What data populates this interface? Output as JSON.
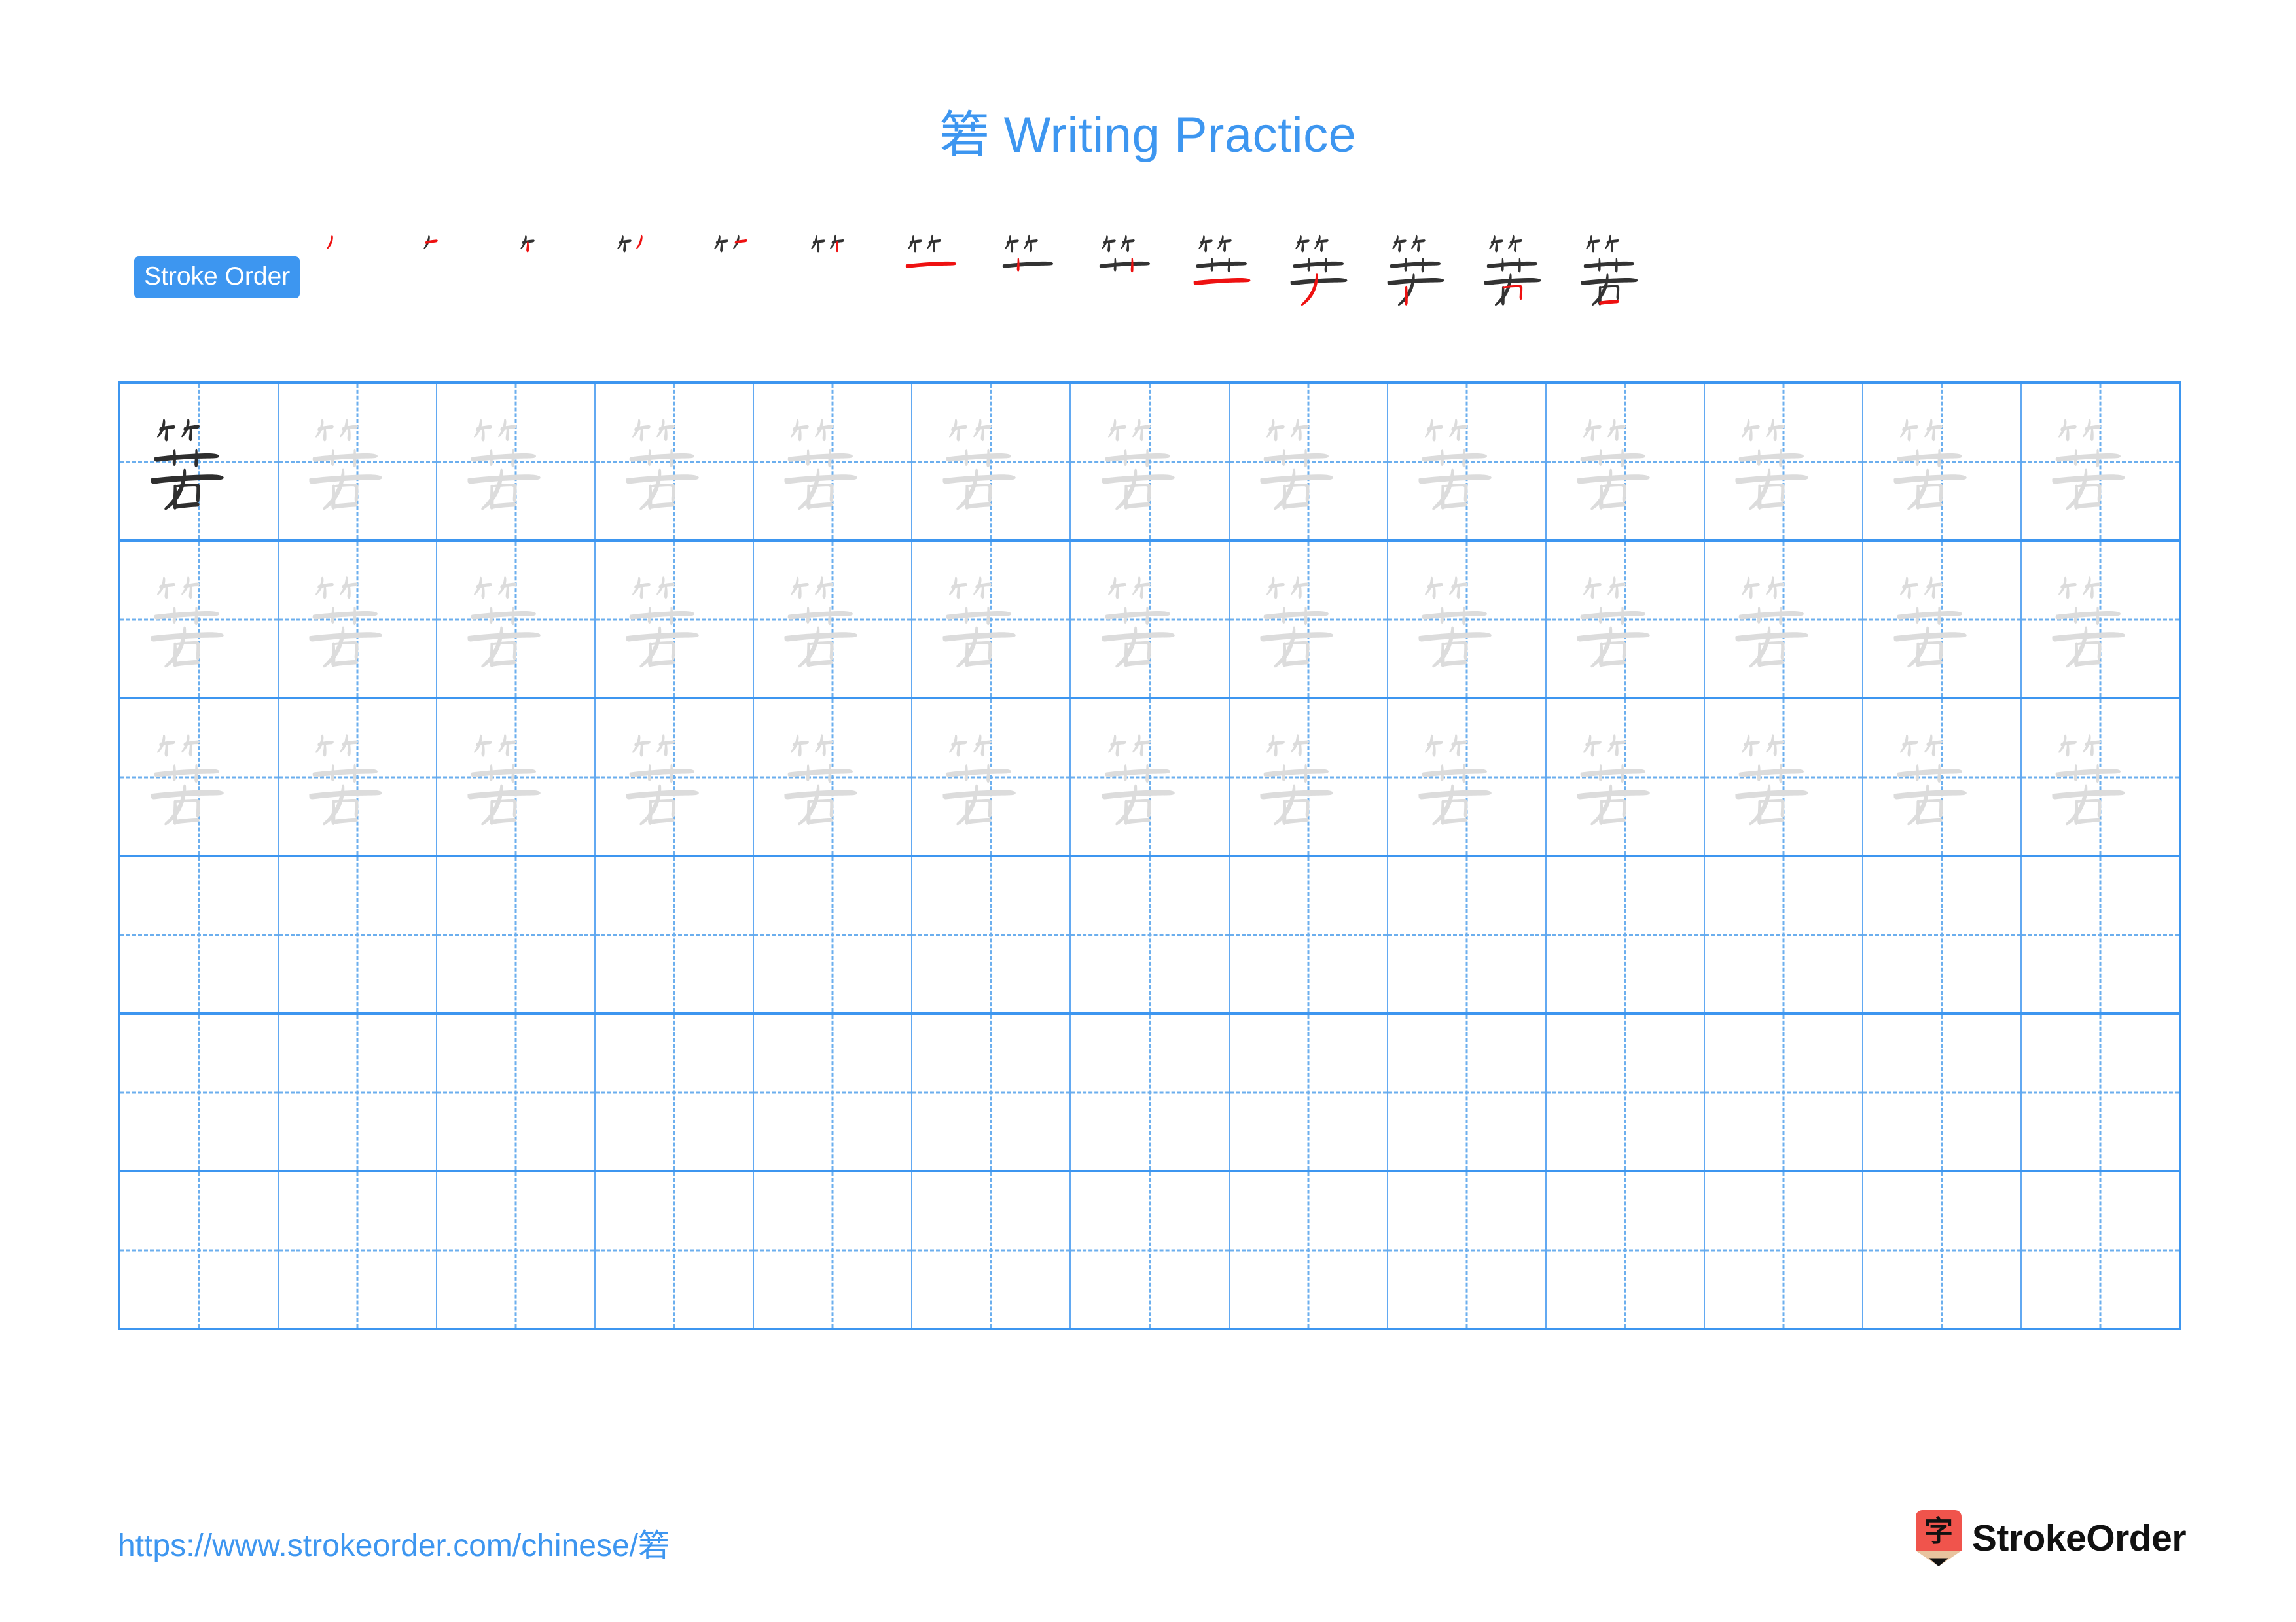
{
  "title": {
    "character": "箬",
    "text": " Writing Practice",
    "color": "#3d96f0"
  },
  "stroke_order": {
    "badge_label": "Stroke Order",
    "badge_bg": "#3d96f0",
    "badge_text_color": "#ffffff",
    "existing_stroke_color": "#333333",
    "new_stroke_color": "#ee1111",
    "total_strokes": 14,
    "steps": [
      {
        "index": 1,
        "strokes_shown": 1,
        "new_stroke": 1
      },
      {
        "index": 2,
        "strokes_shown": 2,
        "new_stroke": 2
      },
      {
        "index": 3,
        "strokes_shown": 3,
        "new_stroke": 3
      },
      {
        "index": 4,
        "strokes_shown": 4,
        "new_stroke": 4
      },
      {
        "index": 5,
        "strokes_shown": 5,
        "new_stroke": 5
      },
      {
        "index": 6,
        "strokes_shown": 6,
        "new_stroke": 6
      },
      {
        "index": 7,
        "strokes_shown": 7,
        "new_stroke": 7
      },
      {
        "index": 8,
        "strokes_shown": 8,
        "new_stroke": 8
      },
      {
        "index": 9,
        "strokes_shown": 9,
        "new_stroke": 9
      },
      {
        "index": 10,
        "strokes_shown": 10,
        "new_stroke": 10
      },
      {
        "index": 11,
        "strokes_shown": 11,
        "new_stroke": 11
      },
      {
        "index": 12,
        "strokes_shown": 12,
        "new_stroke": 12
      },
      {
        "index": 13,
        "strokes_shown": 13,
        "new_stroke": 13
      },
      {
        "index": 14,
        "strokes_shown": 14,
        "new_stroke": 14
      }
    ]
  },
  "practice_grid": {
    "columns": 13,
    "rows": 6,
    "grid_line_color": "#3d96f0",
    "guide_line_color": "#6cafee",
    "model_char_color": "#2e2e2e",
    "trace_char_color": "#dcdcdc",
    "character": "箬",
    "row_fill": [
      {
        "row": 1,
        "model_cells": 1,
        "traced_cells": 12,
        "empty_cells": 0
      },
      {
        "row": 2,
        "model_cells": 0,
        "traced_cells": 13,
        "empty_cells": 0
      },
      {
        "row": 3,
        "model_cells": 0,
        "traced_cells": 13,
        "empty_cells": 0
      },
      {
        "row": 4,
        "model_cells": 0,
        "traced_cells": 0,
        "empty_cells": 13
      },
      {
        "row": 5,
        "model_cells": 0,
        "traced_cells": 0,
        "empty_cells": 13
      },
      {
        "row": 6,
        "model_cells": 0,
        "traced_cells": 0,
        "empty_cells": 13
      }
    ]
  },
  "footer": {
    "url": "https://www.strokeorder.com/chinese/",
    "url_character": "箬",
    "url_color": "#3d96f0",
    "brand_name": "StrokeOrder",
    "logo_character": "字",
    "logo_badge_color": "#f0544c",
    "logo_pencil_wood_color": "#e8c39e",
    "logo_pencil_tip_color": "#111111"
  }
}
